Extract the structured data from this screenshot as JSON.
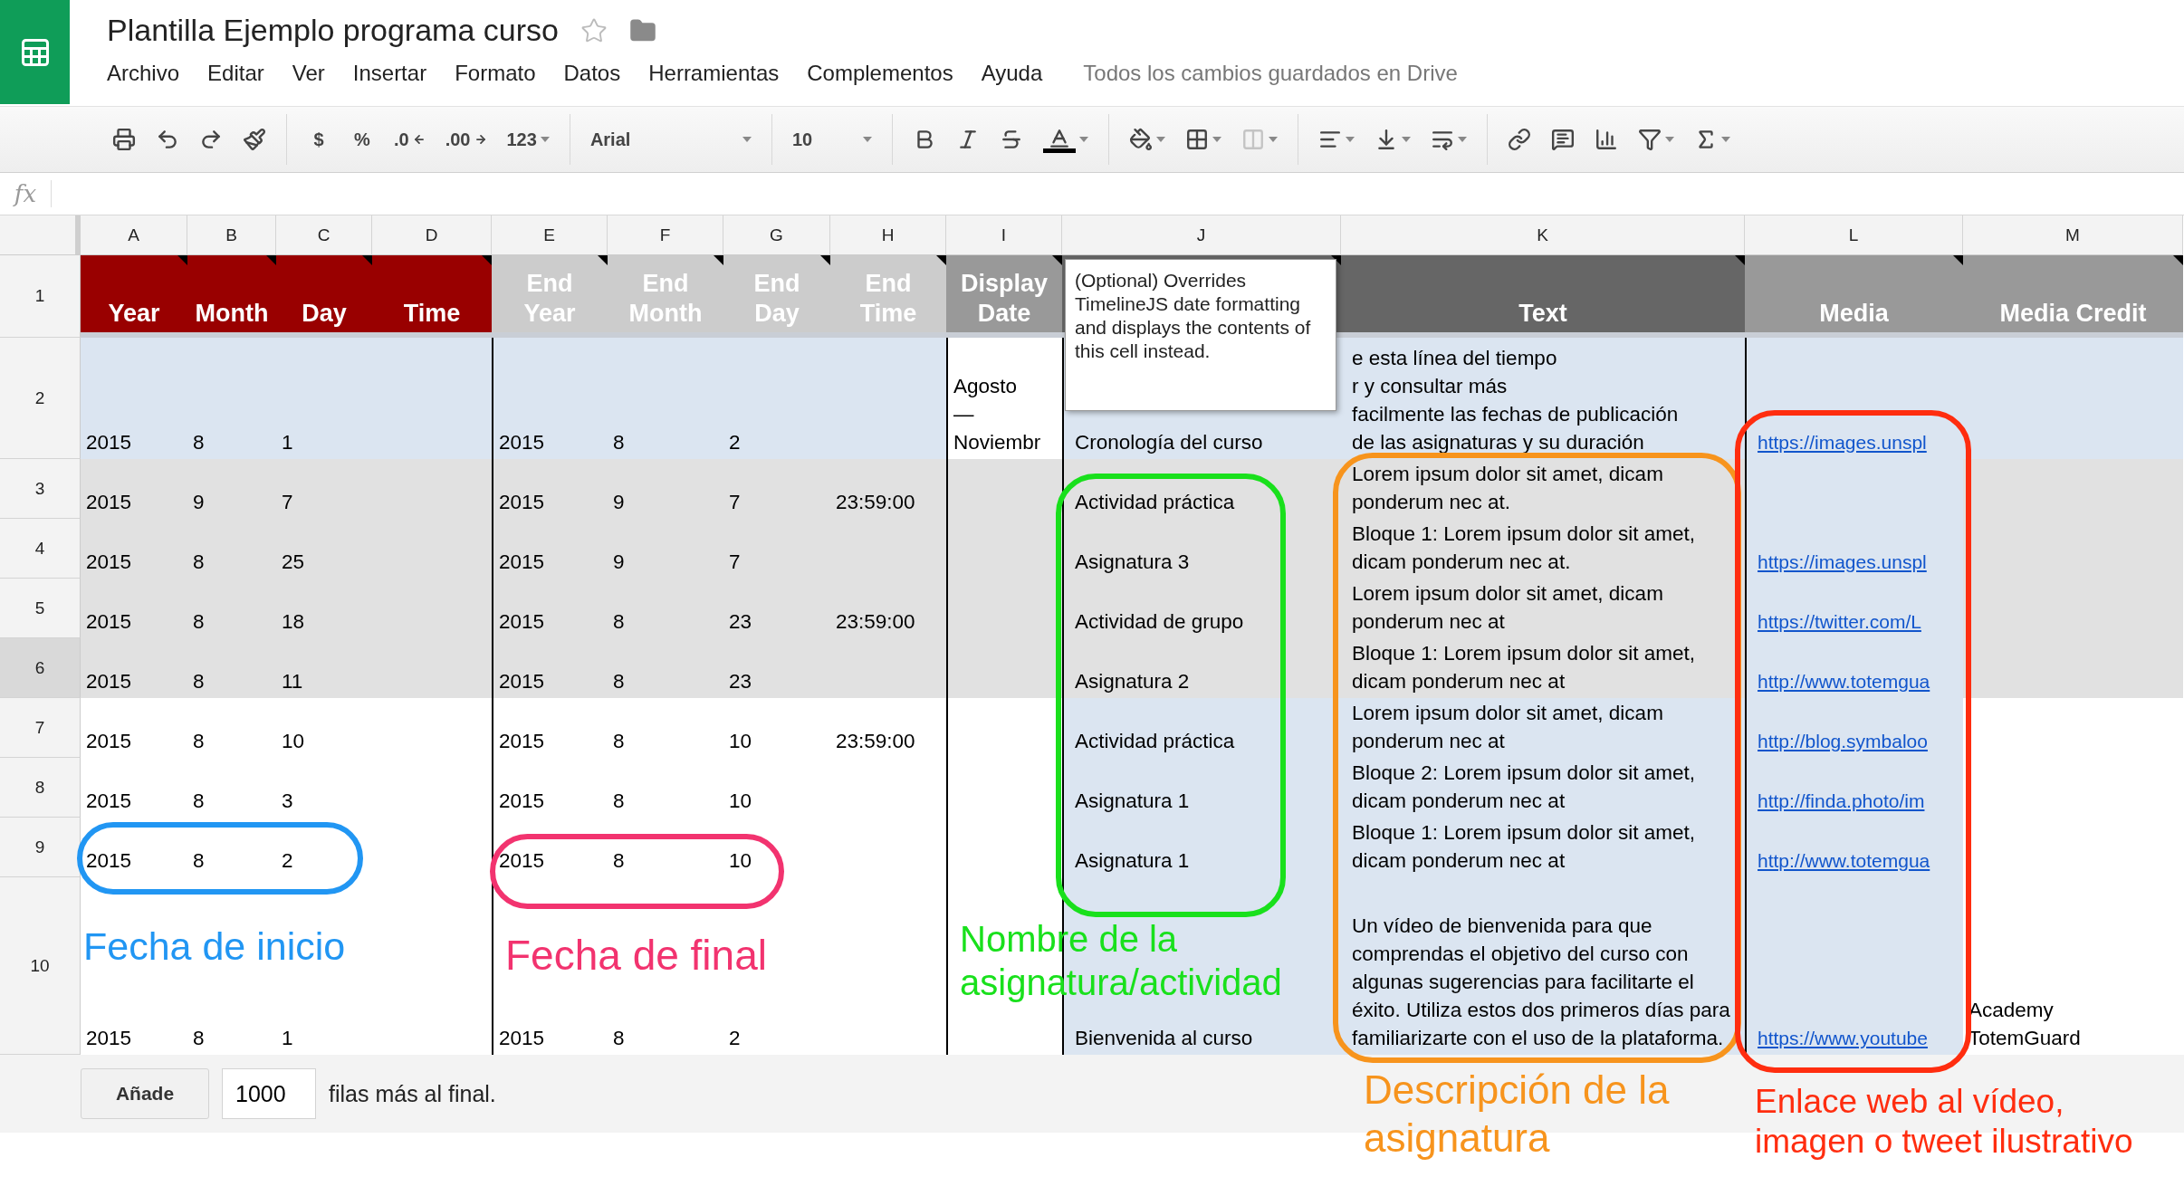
{
  "document": {
    "title": "Plantilla Ejemplo programa curso"
  },
  "menu": [
    "Archivo",
    "Editar",
    "Ver",
    "Insertar",
    "Formato",
    "Datos",
    "Herramientas",
    "Complementos",
    "Ayuda"
  ],
  "save_status": "Todos los cambios guardados en Drive",
  "toolbar": {
    "currency": "$",
    "percent": "%",
    "decrease_decimals": ".0",
    "increase_decimals": ".00",
    "more_formats": "123",
    "font": "Arial",
    "font_size": "10"
  },
  "formula_bar": {
    "label": "fx"
  },
  "columns": [
    {
      "letter": "A",
      "header": "Year",
      "color": "#990000",
      "kind": "date",
      "divider": false
    },
    {
      "letter": "B",
      "header": "Month",
      "color": "#990000",
      "kind": "date",
      "divider": false
    },
    {
      "letter": "C",
      "header": "Day",
      "color": "#990000",
      "kind": "date",
      "divider": false
    },
    {
      "letter": "D",
      "header": "Time",
      "color": "#990000",
      "kind": "date",
      "divider": false
    },
    {
      "letter": "E",
      "header": "End\nYear",
      "color": "#cccccc",
      "kind": "date",
      "divider": true
    },
    {
      "letter": "F",
      "header": "End\nMonth",
      "color": "#cccccc",
      "kind": "date",
      "divider": false
    },
    {
      "letter": "G",
      "header": "End\nDay",
      "color": "#cccccc",
      "kind": "date",
      "divider": false
    },
    {
      "letter": "H",
      "header": "End\nTime",
      "color": "#cccccc",
      "kind": "date",
      "divider": false
    },
    {
      "letter": "I",
      "header": "Display\nDate",
      "color": "#999999",
      "kind": "display",
      "divider": true
    },
    {
      "letter": "J",
      "color": "#666666",
      "kind": "text",
      "divider": true
    },
    {
      "letter": "K",
      "header": "Text",
      "color": "#666666",
      "kind": "text",
      "divider": false
    },
    {
      "letter": "L",
      "header": "Media",
      "color": "#999999",
      "kind": "media",
      "divider": true
    },
    {
      "letter": "M",
      "header": "Media Credit",
      "color": "#999999",
      "kind": "credit",
      "divider": false
    }
  ],
  "header_row": {
    "number": "1"
  },
  "rows": [
    {
      "number": "2",
      "selected": false,
      "highlighted": true,
      "shaded": false,
      "cells": {
        "A": "2015",
        "B": "8",
        "C": "1",
        "E": "2015",
        "F": "8",
        "G": "2",
        "I": "Agosto\n—\nNoviembr",
        "J": "Cronología del curso",
        "K": "e esta línea del tiempo\nr y consultar más\nfacilmente las fechas de publicación\nde las asignaturas y su duración",
        "L": "https://images.unspl"
      }
    },
    {
      "number": "3",
      "selected": false,
      "highlighted": false,
      "shaded": true,
      "cells": {
        "A": "2015",
        "B": "9",
        "C": "7",
        "E": "2015",
        "F": "9",
        "G": "7",
        "H": "23:59:00",
        "J": "Actividad práctica",
        "K": "Lorem ipsum dolor sit amet, dicam ponderum nec at."
      }
    },
    {
      "number": "4",
      "selected": false,
      "highlighted": false,
      "shaded": true,
      "cells": {
        "A": "2015",
        "B": "8",
        "C": "25",
        "E": "2015",
        "F": "9",
        "G": "7",
        "J": "Asignatura 3",
        "K": "Bloque 1: Lorem ipsum dolor sit amet, dicam ponderum nec at.",
        "L": "https://images.unspl"
      }
    },
    {
      "number": "5",
      "selected": false,
      "highlighted": false,
      "shaded": true,
      "cells": {
        "A": "2015",
        "B": "8",
        "C": "18",
        "E": "2015",
        "F": "8",
        "G": "23",
        "H": "23:59:00",
        "J": "Actividad de grupo",
        "K": "Lorem ipsum dolor sit amet, dicam ponderum nec at",
        "L": "https://twitter.com/L"
      }
    },
    {
      "number": "6",
      "selected": true,
      "highlighted": false,
      "shaded": true,
      "cells": {
        "A": "2015",
        "B": "8",
        "C": "11",
        "E": "2015",
        "F": "8",
        "G": "23",
        "J": "Asignatura 2",
        "K": "Bloque 1: Lorem ipsum dolor sit amet, dicam ponderum nec at",
        "L": "http://www.totemgua"
      }
    },
    {
      "number": "7",
      "selected": false,
      "highlighted": false,
      "shaded": false,
      "cells": {
        "A": "2015",
        "B": "8",
        "C": "10",
        "E": "2015",
        "F": "8",
        "G": "10",
        "H": "23:59:00",
        "J": "Actividad práctica",
        "K": "Lorem ipsum dolor sit amet, dicam ponderum nec at",
        "L": "http://blog.symbaloo"
      }
    },
    {
      "number": "8",
      "selected": false,
      "highlighted": false,
      "shaded": false,
      "cells": {
        "A": "2015",
        "B": "8",
        "C": "3",
        "E": "2015",
        "F": "8",
        "G": "10",
        "J": "Asignatura 1",
        "K": "Bloque 2: Lorem ipsum dolor sit amet, dicam ponderum nec at",
        "L": "http://finda.photo/im"
      }
    },
    {
      "number": "9",
      "selected": false,
      "highlighted": false,
      "shaded": false,
      "cells": {
        "A": "2015",
        "B": "8",
        "C": "2",
        "E": "2015",
        "F": "8",
        "G": "10",
        "J": "Asignatura 1",
        "K": "Bloque 1: Lorem ipsum dolor sit amet, dicam ponderum nec at",
        "L": "http://www.totemgua"
      }
    },
    {
      "number": "10",
      "selected": false,
      "highlighted": false,
      "shaded": false,
      "cells": {
        "A": "2015",
        "B": "8",
        "C": "1",
        "E": "2015",
        "F": "8",
        "G": "2",
        "J": "Bienvenida al curso",
        "K": "Un vídeo de bienvenida para que comprendas el objetivo del curso con algunas sugerencias para facilitarte el éxito. Utiliza estos dos primeros días para familiarizarte con el uso de la plataforma.",
        "L": "https://www.youtube",
        "M": "Academy\nTotemGuard"
      }
    }
  ],
  "note": "(Optional) Overrides TimelineJS date formatting and displays the contents of this cell instead.",
  "add_rows": {
    "button": "Añade",
    "count": "1000",
    "suffix": "filas más al final."
  },
  "annotations": [
    {
      "label": "Fecha de inicio",
      "color": "#2196f3"
    },
    {
      "label": "Fecha de final",
      "color": "#f2336f"
    },
    {
      "label": "Nombre de la\nasignatura/actividad",
      "color": "#19e01c"
    },
    {
      "label": "Descripción de la\nasignatura",
      "color": "#f7941d"
    },
    {
      "label": "Enlace web al vídeo,\nimagen o tweet ilustrativo",
      "color": "#ff2d0f"
    }
  ]
}
